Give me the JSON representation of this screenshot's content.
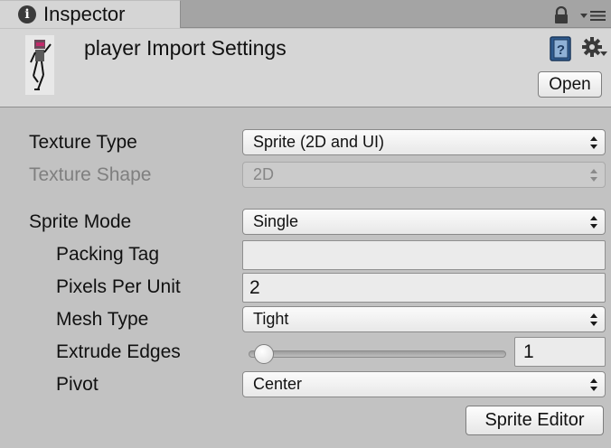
{
  "tab": {
    "icon": "info-icon",
    "icon_glyph": "i",
    "label": "Inspector"
  },
  "toolbar": {
    "lock_icon": "lock-icon",
    "menu_icon": "tab-menu-icon"
  },
  "header": {
    "title": "player Import Settings",
    "help_icon": "help-book-icon",
    "settings_icon": "gear-icon",
    "open_label": "Open"
  },
  "properties": {
    "texture_type": {
      "label": "Texture Type",
      "value": "Sprite (2D and UI)"
    },
    "texture_shape": {
      "label": "Texture Shape",
      "value": "2D",
      "disabled": true
    },
    "sprite_mode": {
      "label": "Sprite Mode",
      "value": "Single"
    },
    "packing_tag": {
      "label": "Packing Tag",
      "value": ""
    },
    "pixels_per_unit": {
      "label": "Pixels Per Unit",
      "value": "2"
    },
    "mesh_type": {
      "label": "Mesh Type",
      "value": "Tight"
    },
    "extrude_edges": {
      "label": "Extrude Edges",
      "value": "1",
      "slider_fraction": 0.03
    },
    "pivot": {
      "label": "Pivot",
      "value": "Center"
    }
  },
  "sprite_editor_label": "Sprite Editor",
  "colors": {
    "panel_background": "#c2c2c2",
    "header_background": "#d6d6d6",
    "tab_strip": "#a4a4a4",
    "disabled_text": "#7f7f7f"
  }
}
